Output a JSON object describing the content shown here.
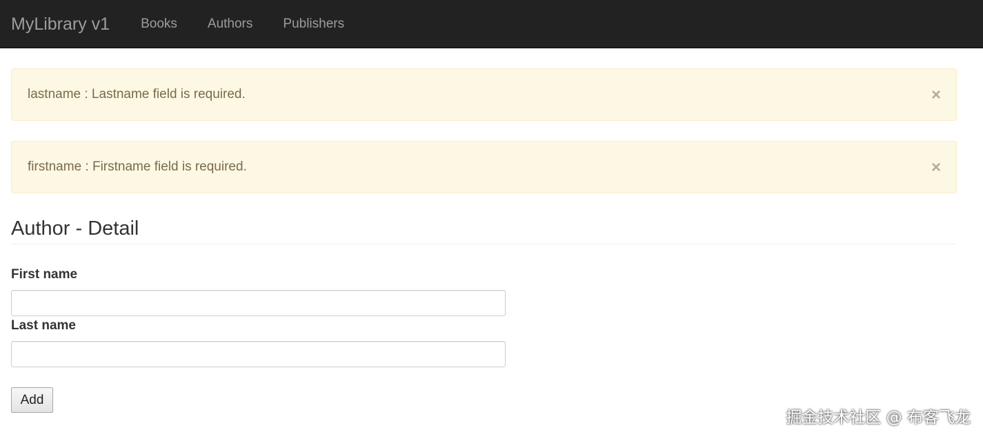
{
  "navbar": {
    "brand": "MyLibrary v1",
    "items": [
      {
        "label": "Books"
      },
      {
        "label": "Authors"
      },
      {
        "label": "Publishers"
      }
    ]
  },
  "alerts": [
    {
      "message": "lastname : Lastname field is required.",
      "close": "×"
    },
    {
      "message": "firstname : Firstname field is required.",
      "close": "×"
    }
  ],
  "page": {
    "title": "Author - Detail"
  },
  "form": {
    "first_name": {
      "label": "First name",
      "value": ""
    },
    "last_name": {
      "label": "Last name",
      "value": ""
    },
    "submit_label": "Add"
  },
  "watermark": "掘金技术社区 @ 布客飞龙",
  "colors": {
    "navbar_bg": "#222222",
    "alert_bg": "#fcf8e3",
    "alert_border": "#faebcc"
  }
}
